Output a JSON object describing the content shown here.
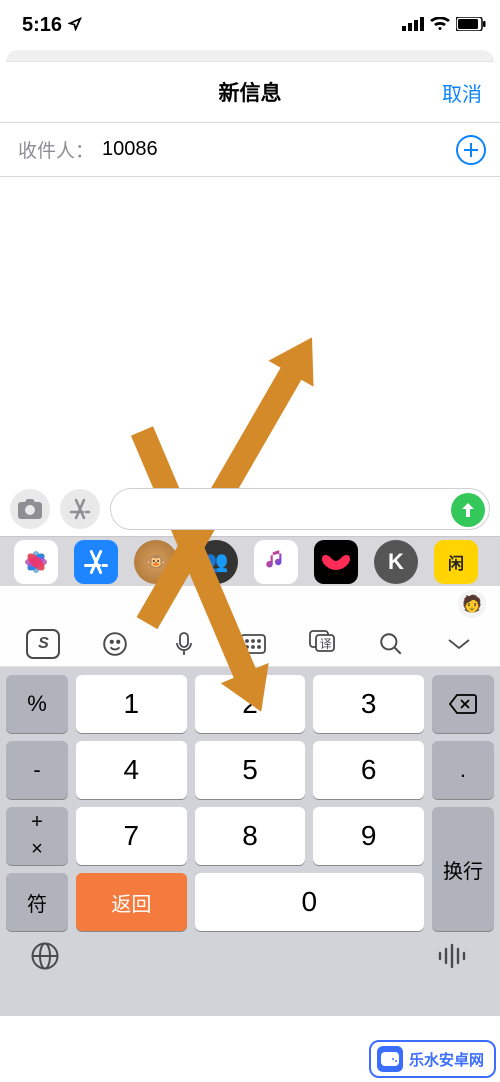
{
  "status": {
    "time": "5:16",
    "signal": "▪▪▪▪",
    "wifi": true,
    "battery": true
  },
  "nav": {
    "title": "新信息",
    "cancel": "取消"
  },
  "to": {
    "label": "收件人：",
    "value": "10086"
  },
  "compose": {
    "placeholder": ""
  },
  "keyboard": {
    "row1": [
      "%",
      "1",
      "2",
      "3",
      "⌫"
    ],
    "row2": [
      "-",
      "4",
      "5",
      "6",
      "."
    ],
    "row3": [
      "+",
      "7",
      "8",
      "9"
    ],
    "row3_side_top": "×",
    "row4": [
      "符",
      "返回",
      "0",
      "换行"
    ],
    "dismiss": "⌄"
  },
  "toolbar": {
    "sogou": "S",
    "translate": "译",
    "keyboard_icon": "⌨"
  },
  "watermark": "乐水安卓网"
}
